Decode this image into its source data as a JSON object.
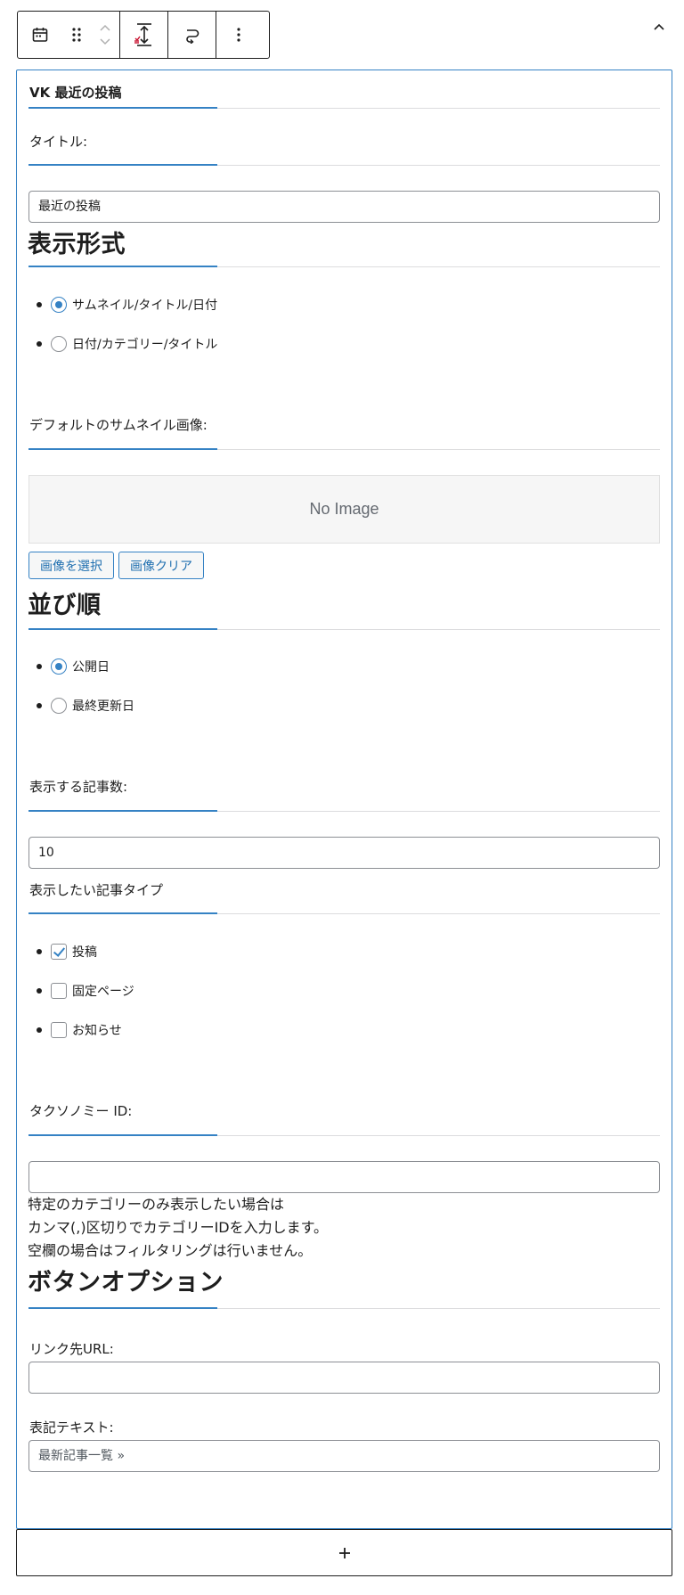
{
  "toolbar": {
    "icons": [
      "calendar-icon",
      "drag-handle-icon",
      "move-up-icon",
      "move-down-icon",
      "height-adjust-icon",
      "transform-icon",
      "more-options-icon"
    ]
  },
  "widget": {
    "title": "VK 最近の投稿",
    "title_field": {
      "label": "タイトル:",
      "value": "最近の投稿"
    },
    "display_format": {
      "heading": "表示形式",
      "options": [
        {
          "label": "サムネイル/タイトル/日付",
          "checked": true
        },
        {
          "label": "日付/カテゴリー/タイトル",
          "checked": false
        }
      ]
    },
    "thumbnail": {
      "label": "デフォルトのサムネイル画像:",
      "placeholder": "No Image",
      "select_button": "画像を選択",
      "clear_button": "画像クリア"
    },
    "order": {
      "heading": "並び順",
      "options": [
        {
          "label": "公開日",
          "checked": true
        },
        {
          "label": "最終更新日",
          "checked": false
        }
      ]
    },
    "post_count": {
      "label": "表示する記事数:",
      "value": "10"
    },
    "post_types": {
      "label": "表示したい記事タイプ",
      "options": [
        {
          "label": "投稿",
          "checked": true
        },
        {
          "label": "固定ページ",
          "checked": false
        },
        {
          "label": "お知らせ",
          "checked": false
        }
      ]
    },
    "taxonomy": {
      "label": "タクソノミー ID:",
      "value": "",
      "help": [
        "特定のカテゴリーのみ表示したい場合は",
        "カンマ(,)区切りでカテゴリーIDを入力します。",
        "空欄の場合はフィルタリングは行いません。"
      ]
    },
    "button_options": {
      "heading": "ボタンオプション",
      "link_label": "リンク先URL:",
      "link_value": "",
      "text_label": "表記テキスト:",
      "text_value": "最新記事一覧 »"
    }
  },
  "colors": {
    "accent": "#3582c4",
    "border": "#1e1e1e",
    "input_border": "#8c8f94"
  }
}
